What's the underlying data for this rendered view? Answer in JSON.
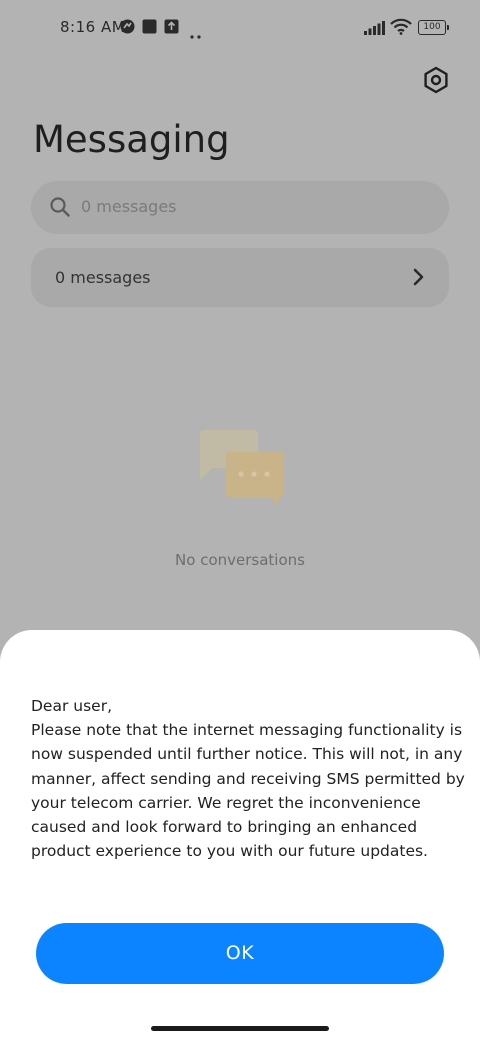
{
  "status_bar": {
    "time": "8:16 AM",
    "battery": "100",
    "icons": [
      "messenger-icon",
      "square-app-icon",
      "upload-icon",
      "more-dots-icon",
      "signal-icon",
      "wifi-icon",
      "battery-icon"
    ]
  },
  "header": {
    "title": "Messaging",
    "settings_icon": "settings-icon"
  },
  "search": {
    "placeholder": "0 messages",
    "icon": "search-icon"
  },
  "message_summary": {
    "label": "0 messages",
    "chevron_icon": "chevron-right-icon"
  },
  "empty_state": {
    "icon": "chat-bubbles-icon",
    "label": "No conversations"
  },
  "dialog": {
    "text": "Dear user,\nPlease note that the internet messaging functionality is now suspended until further notice. This will not, in any manner, affect sending and receiving SMS permitted by your telecom carrier. We regret the inconvenience caused and look forward to bringing an enhanced product experience to you with our future updates.",
    "ok_label": "OK"
  },
  "colors": {
    "accent": "#0d84ff",
    "overlay_background": "#b3b3b3",
    "sheet_background": "#ffffff"
  }
}
